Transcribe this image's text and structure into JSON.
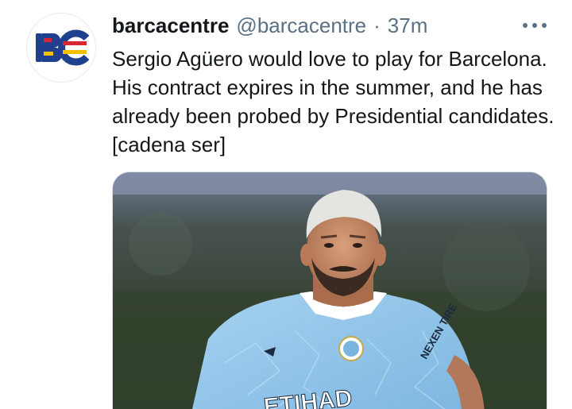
{
  "tweet": {
    "display_name": "barcacentre",
    "handle": "@barcacentre",
    "separator": "·",
    "time": "37m",
    "text": "Sergio Agüero would love to play for Barcelona. His contract expires in the summer, and he has already been probed by Presidential candidates. [cadena ser]",
    "more_icon": "more-dots-icon"
  },
  "avatar": {
    "logo_text": "BC",
    "colors": {
      "blue": "#1f3f8f",
      "red": "#d6262f",
      "yellow": "#f2c200"
    }
  },
  "media": {
    "description_icon": "photo-footballer",
    "jersey_text": "ETIHAD",
    "sleeve_text": "NEXEN TIRE",
    "colors": {
      "jersey": "#8fc3e8",
      "hair": "#e4e4e0",
      "skin": "#c98d6b",
      "background": "#3a4a3c"
    }
  }
}
